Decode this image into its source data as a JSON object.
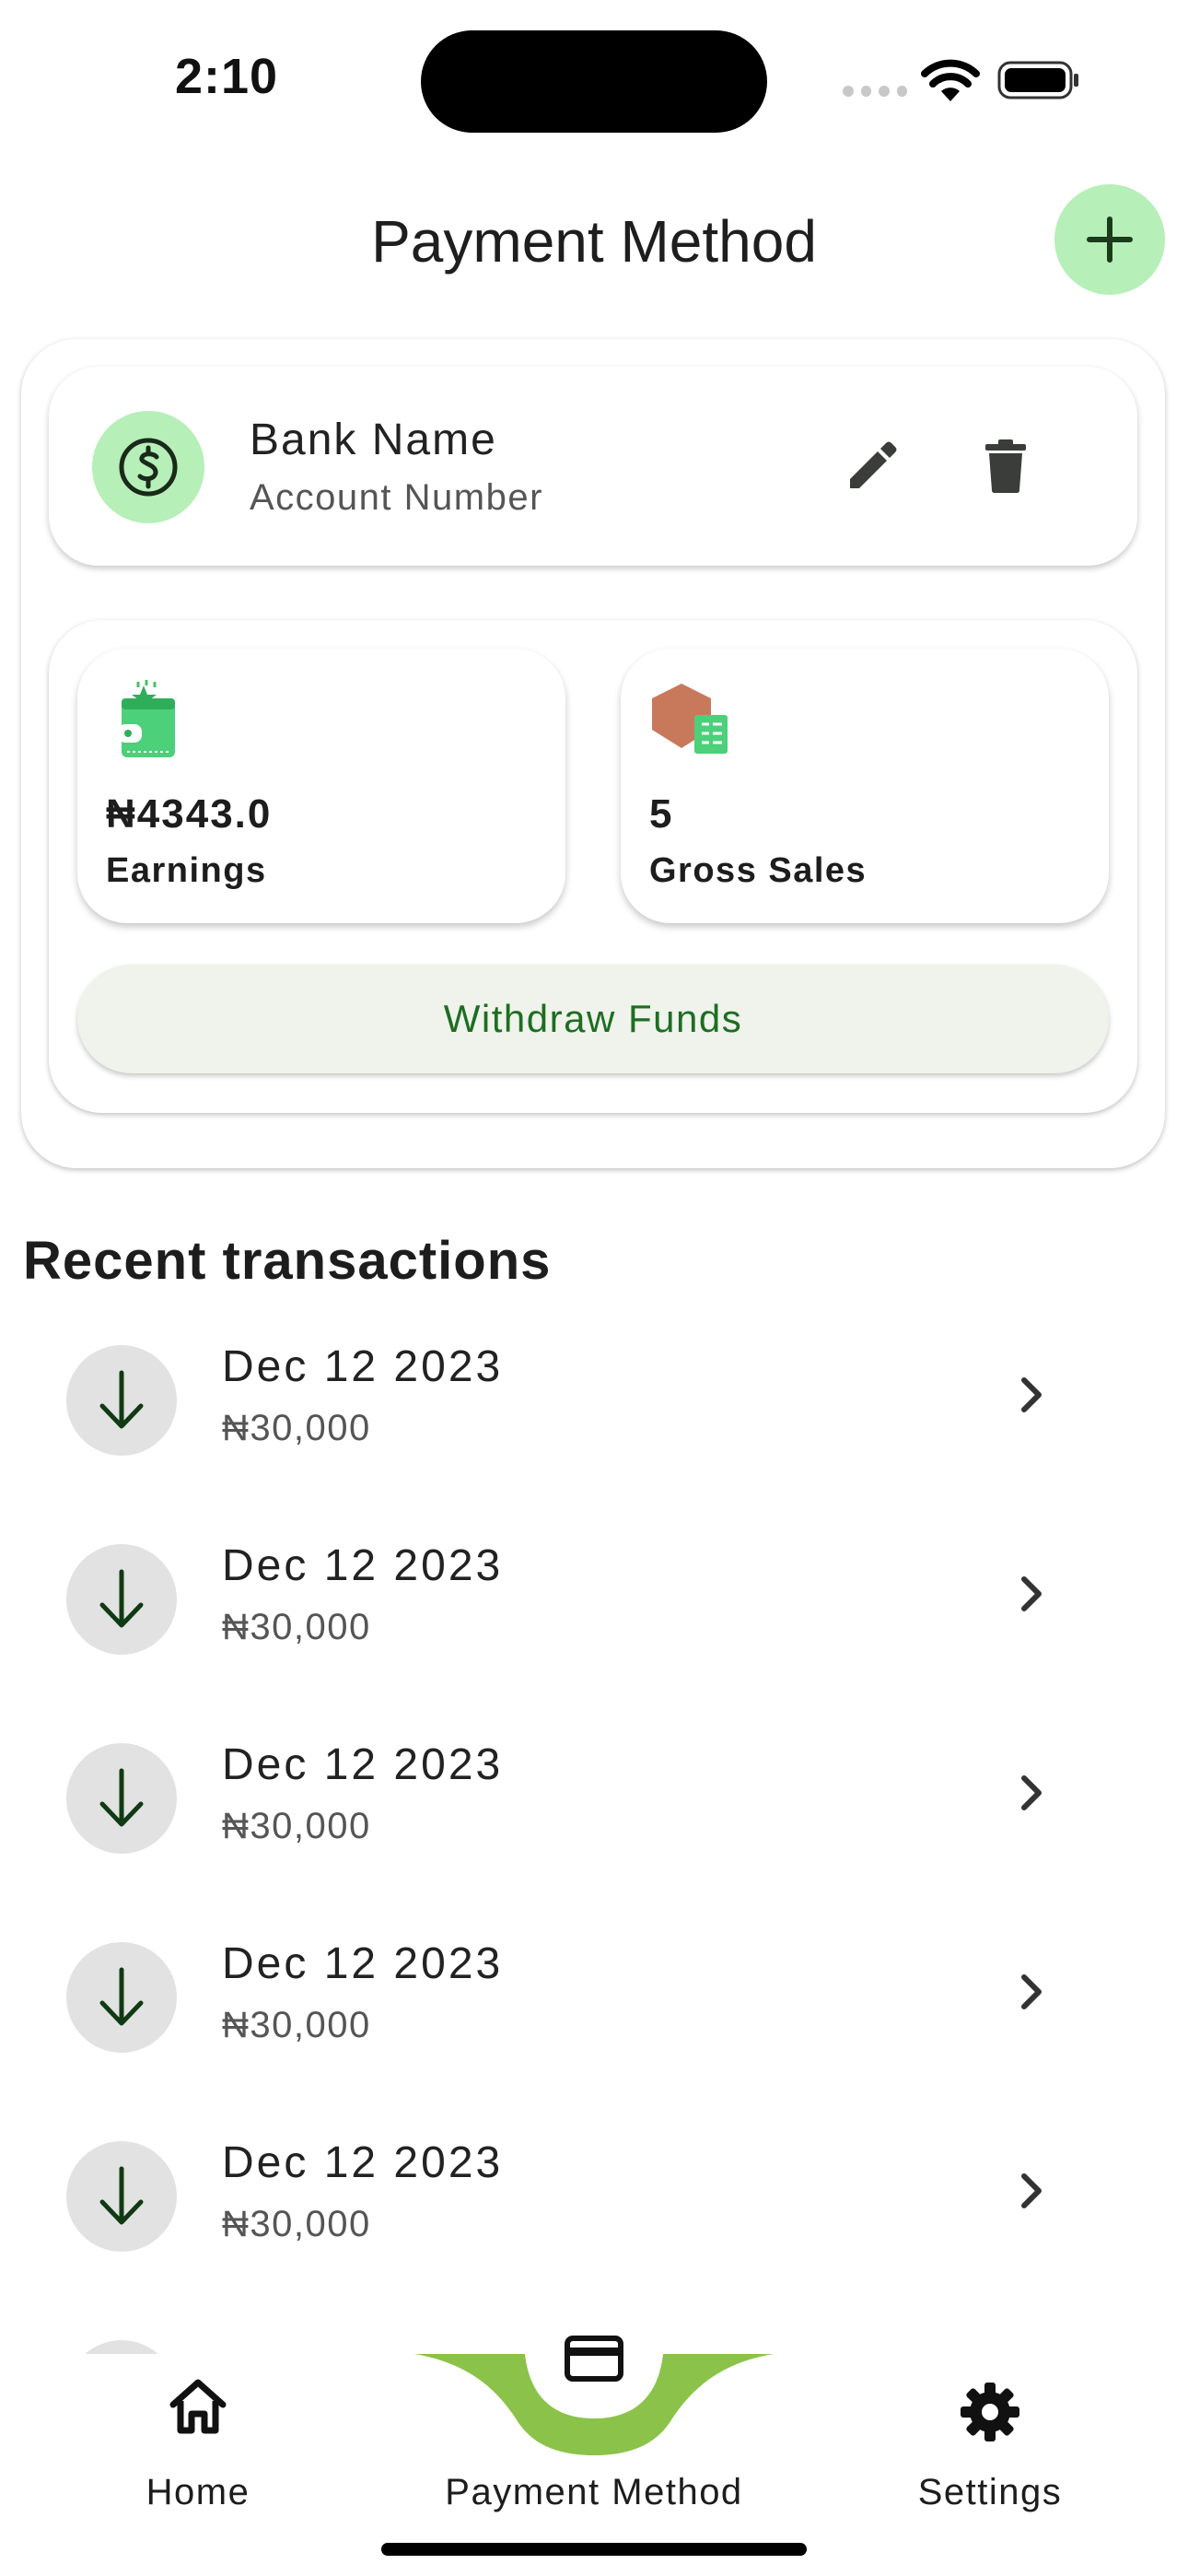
{
  "status_bar": {
    "time": "2:10"
  },
  "header": {
    "title": "Payment Method"
  },
  "bank": {
    "name": "Bank Name",
    "account": "Account Number"
  },
  "stats": {
    "earnings": {
      "value": "₦4343.0",
      "label": "Earnings"
    },
    "sales": {
      "value": "5",
      "label": "Gross Sales"
    }
  },
  "withdraw": {
    "label": "Withdraw Funds"
  },
  "transactions": {
    "title": "Recent transactions",
    "items": [
      {
        "date": "Dec 12 2023",
        "amount": "₦30,000"
      },
      {
        "date": "Dec 12 2023",
        "amount": "₦30,000"
      },
      {
        "date": "Dec 12 2023",
        "amount": "₦30,000"
      },
      {
        "date": "Dec 12 2023",
        "amount": "₦30,000"
      },
      {
        "date": "Dec 12 2023",
        "amount": "₦30,000"
      }
    ]
  },
  "nav": {
    "home": "Home",
    "payment": "Payment Method",
    "settings": "Settings",
    "active": "payment"
  },
  "colors": {
    "accent_light": "#b6efb8",
    "nav_curve": "#8bc34a",
    "withdraw_text": "#1e6d22",
    "withdraw_bg": "#eff3eb"
  }
}
